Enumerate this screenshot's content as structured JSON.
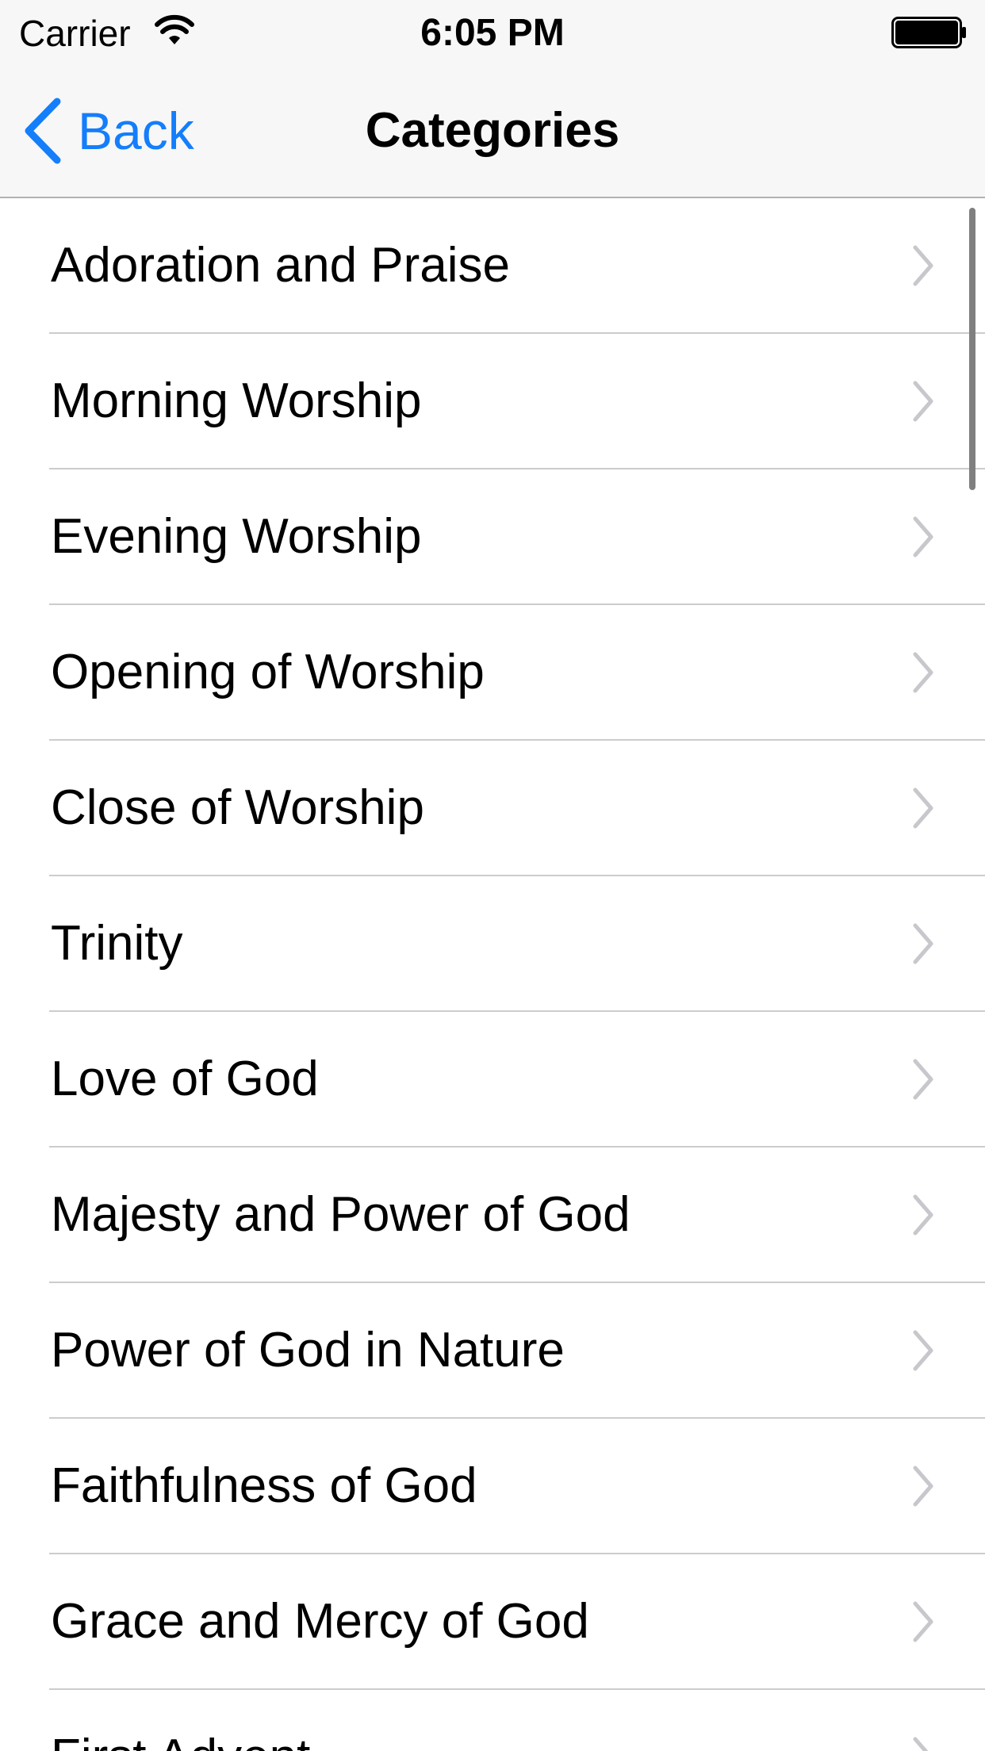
{
  "status_bar": {
    "carrier": "Carrier",
    "time": "6:05 PM",
    "wifi_icon": "wifi-icon",
    "battery_icon": "battery-icon",
    "battery_level": 1.0
  },
  "nav_bar": {
    "back_label": "Back",
    "title": "Categories",
    "accent_color": "#147efb"
  },
  "list": {
    "items": [
      {
        "label": "Adoration and Praise"
      },
      {
        "label": "Morning Worship"
      },
      {
        "label": "Evening Worship"
      },
      {
        "label": "Opening of Worship"
      },
      {
        "label": "Close of Worship"
      },
      {
        "label": "Trinity"
      },
      {
        "label": "Love of God"
      },
      {
        "label": "Majesty and Power of God"
      },
      {
        "label": "Power of God in Nature"
      },
      {
        "label": "Faithfulness of God"
      },
      {
        "label": "Grace and Mercy of God"
      },
      {
        "label": "First Advent"
      }
    ],
    "disclosure_icon": "chevron-right-icon"
  }
}
